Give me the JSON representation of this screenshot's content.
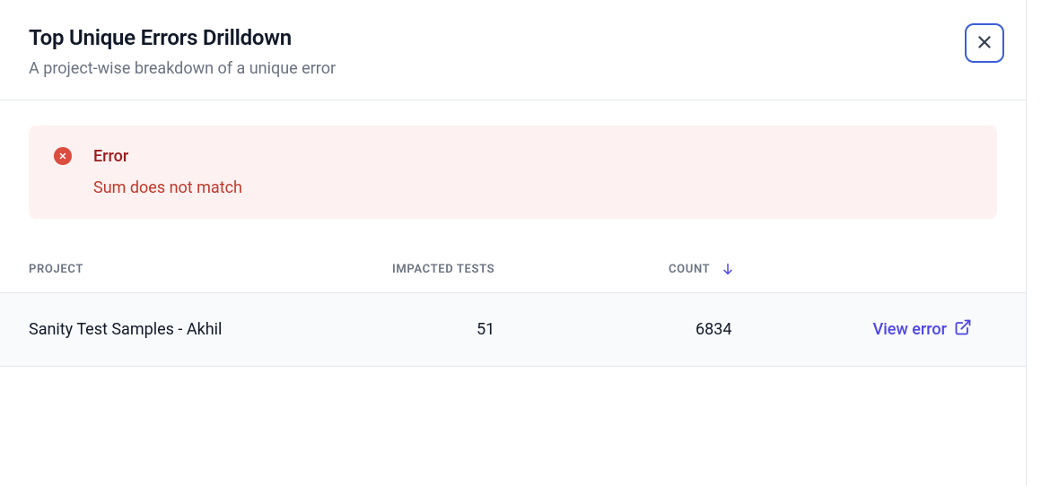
{
  "header": {
    "title": "Top Unique Errors Drilldown",
    "subtitle": "A project-wise breakdown of a unique error"
  },
  "error_banner": {
    "title": "Error",
    "message": "Sum does not match"
  },
  "table": {
    "columns": {
      "project": "PROJECT",
      "impacted_tests": "IMPACTED TESTS",
      "count": "COUNT"
    },
    "rows": [
      {
        "project": "Sanity Test Samples - Akhil",
        "impacted_tests": "51",
        "count": "6834",
        "action_label": "View error"
      }
    ]
  }
}
